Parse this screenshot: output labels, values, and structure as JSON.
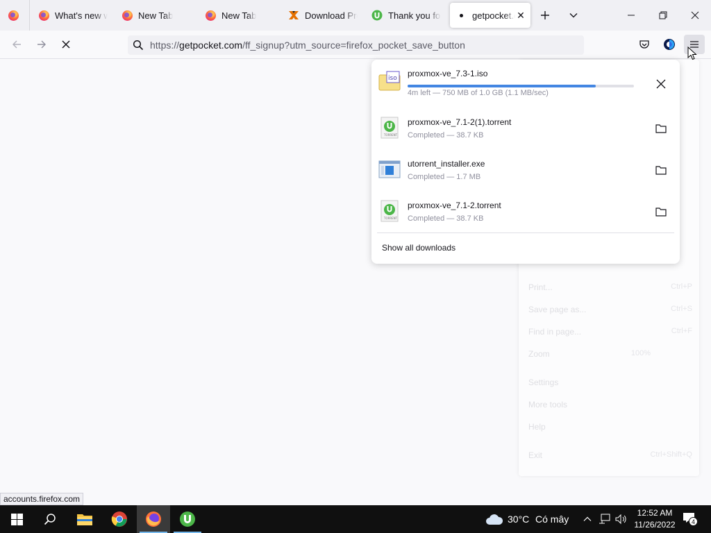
{
  "tabs": [
    {
      "title": "",
      "icon": "firefox-icon"
    },
    {
      "title": "What's new with Firefox",
      "icon": "firefox-icon"
    },
    {
      "title": "New Tab",
      "icon": "firefox-icon"
    },
    {
      "title": "New Tab",
      "icon": "firefox-icon"
    },
    {
      "title": "Download Proxmox",
      "icon": "proxmox-icon"
    },
    {
      "title": "Thank you for",
      "icon": "utorrent-icon"
    },
    {
      "title": "getpocket.com",
      "icon": "loading-dot-icon",
      "active": true
    }
  ],
  "urlbar": {
    "prefix": "https://",
    "domain": "getpocket.com",
    "path": "/ff_signup?utm_source=firefox_pocket_save_button"
  },
  "downloads": {
    "items": [
      {
        "name": "proxmox-ve_7.3-1.iso",
        "status": "4m left — 750 MB of 1.0 GB (1.1 MB/sec)",
        "progress": 0.83,
        "icon": "iso-file-icon",
        "action": "cancel"
      },
      {
        "name": "proxmox-ve_7.1-2(1).torrent",
        "status": "Completed — 38.7 KB",
        "icon": "torrent-file-icon",
        "action": "folder"
      },
      {
        "name": "utorrent_installer.exe",
        "status": "Completed — 1.7 MB",
        "icon": "exe-file-icon",
        "action": "folder"
      },
      {
        "name": "proxmox-ve_7.1-2.torrent",
        "status": "Completed — 38.7 KB",
        "icon": "torrent-file-icon",
        "action": "folder"
      }
    ],
    "show_all": "Show all downloads"
  },
  "ghost_menu": [
    {
      "label": "Print...",
      "shortcut": "Ctrl+P"
    },
    {
      "label": "Save page as...",
      "shortcut": "Ctrl+S"
    },
    {
      "label": "Find in page...",
      "shortcut": "Ctrl+F"
    },
    {
      "label": "Zoom",
      "shortcut": "100%"
    },
    {
      "label": "Settings",
      "shortcut": ""
    },
    {
      "label": "More tools",
      "shortcut": ""
    },
    {
      "label": "Help",
      "shortcut": ""
    },
    {
      "label": "Exit",
      "shortcut": "Ctrl+Shift+Q"
    }
  ],
  "status_tooltip": "accounts.firefox.com",
  "taskbar": {
    "weather_temp": "30°C",
    "weather_desc": "Có mây",
    "time": "12:52 AM",
    "date": "11/26/2022",
    "notifications": "4"
  },
  "colors": {
    "accent": "#0060df",
    "taskbar": "#101010"
  }
}
